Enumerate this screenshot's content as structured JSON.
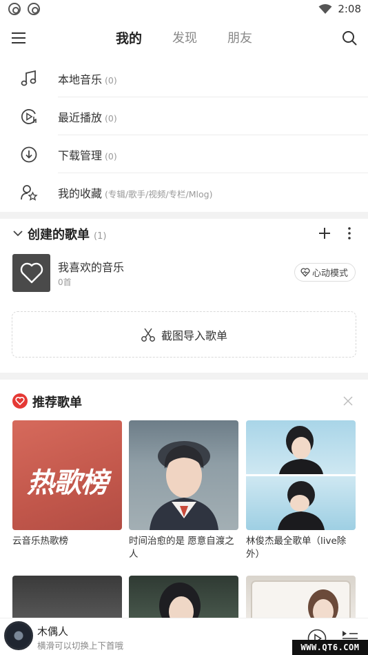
{
  "status_bar": {
    "time": "2:08"
  },
  "header": {
    "tabs": [
      {
        "label": "我的",
        "active": true
      },
      {
        "label": "发现",
        "active": false
      },
      {
        "label": "朋友",
        "active": false
      }
    ]
  },
  "local_items": [
    {
      "label": "本地音乐",
      "count": "(0)",
      "icon": "music-note-icon"
    },
    {
      "label": "最近播放",
      "count": "(0)",
      "icon": "recent-play-icon"
    },
    {
      "label": "下载管理",
      "count": "(0)",
      "icon": "download-icon"
    },
    {
      "label": "我的收藏",
      "count": "(专辑/歌手/视频/专栏/Mlog)",
      "icon": "collection-icon"
    }
  ],
  "created": {
    "title": "创建的歌单",
    "count": "(1)",
    "favorite": {
      "title": "我喜欢的音乐",
      "subtitle": "0首",
      "mode_label": "心动模式"
    },
    "import_label": "截图导入歌单"
  },
  "recommended": {
    "title": "推荐歌单",
    "cards": [
      {
        "caption": "云音乐热歌榜",
        "cover_text": "热歌榜"
      },
      {
        "caption": "时间治愈的是 愿意自渡之人"
      },
      {
        "caption": "林俊杰最全歌单（live除外）"
      }
    ]
  },
  "player": {
    "title": "木偶人",
    "subtitle": "横滑可以切换上下首哦"
  },
  "watermark": "WWW.QT6.COM",
  "colors": {
    "accent": "#e53935",
    "text": "#333333",
    "muted": "#999999"
  }
}
